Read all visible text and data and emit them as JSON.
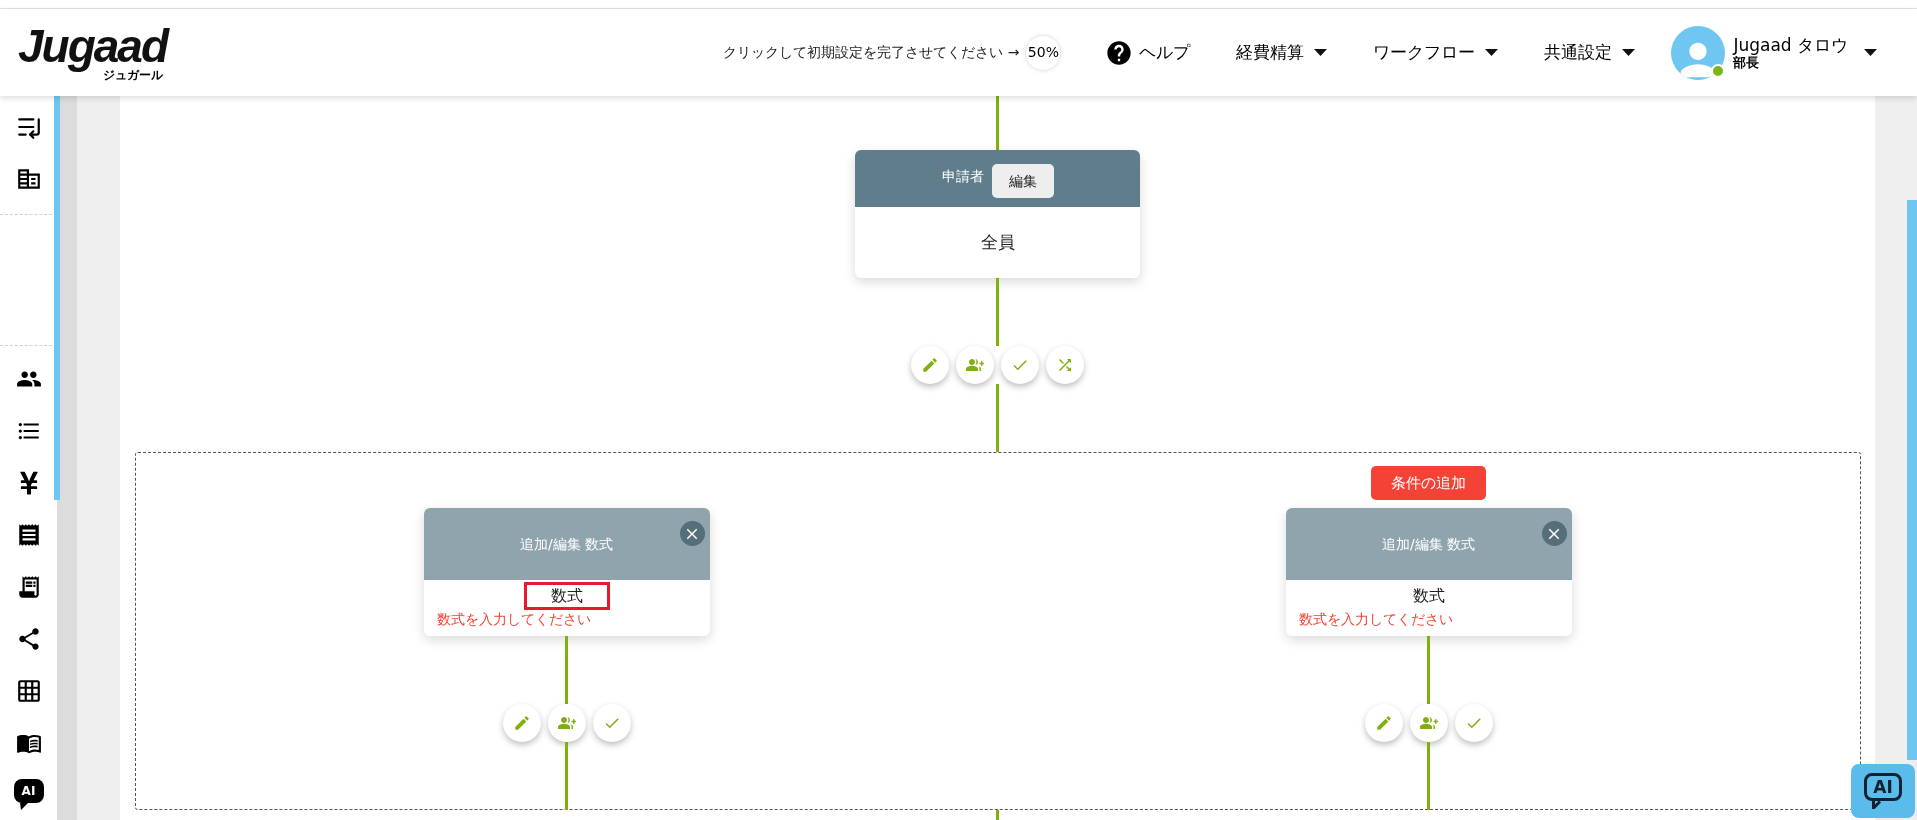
{
  "header": {
    "logo": {
      "wordmark": "Jugaad",
      "subtitle": "ジュガール"
    },
    "setup": {
      "text": "クリックして初期設定を完了させてください →",
      "percent": "50%"
    },
    "help": "ヘルプ",
    "menus": [
      {
        "label": "経費精算"
      },
      {
        "label": "ワークフロー"
      },
      {
        "label": "共通設定"
      }
    ],
    "user": {
      "name": "Jugaad タロウ",
      "role": "部長",
      "online": true
    }
  },
  "sidebar": {
    "top_items": [
      {
        "kind": "collapse"
      },
      {
        "kind": "company"
      }
    ],
    "items": [
      {
        "kind": "people"
      },
      {
        "kind": "list"
      },
      {
        "kind": "yen"
      },
      {
        "kind": "receipt"
      },
      {
        "kind": "report"
      },
      {
        "kind": "share"
      },
      {
        "kind": "grid"
      },
      {
        "kind": "book"
      },
      {
        "kind": "ai",
        "label": "AI"
      }
    ]
  },
  "flow": {
    "applicant": {
      "title": "申請者",
      "edit_button": "編集",
      "value": "全員",
      "actions": [
        {
          "kind": "edit"
        },
        {
          "kind": "add-approver"
        },
        {
          "kind": "approve"
        },
        {
          "kind": "branch"
        }
      ]
    },
    "branches": [
      {
        "title": "追加/編集 数式",
        "label": "数式",
        "label_highlighted": true,
        "error": "数式を入力してください",
        "actions": [
          {
            "kind": "edit"
          },
          {
            "kind": "add-approver"
          },
          {
            "kind": "approve"
          }
        ]
      },
      {
        "add_condition_button": "条件の追加",
        "title": "追加/編集 数式",
        "label": "数式",
        "label_highlighted": false,
        "error": "数式を入力してください",
        "actions": [
          {
            "kind": "edit"
          },
          {
            "kind": "add-approver"
          },
          {
            "kind": "approve"
          }
        ]
      }
    ]
  },
  "ai_button": {
    "label": "AI"
  }
}
